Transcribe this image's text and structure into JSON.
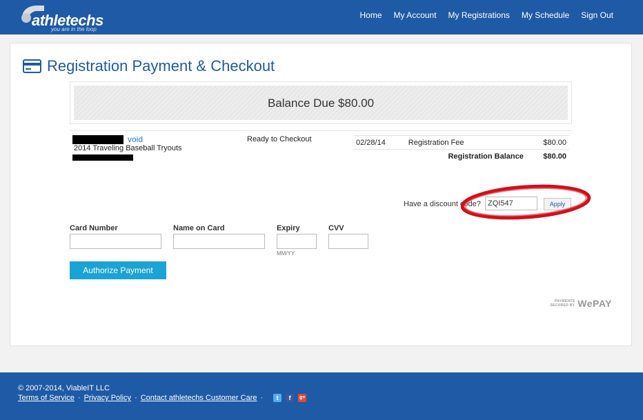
{
  "header": {
    "logo_text": "athletechs",
    "logo_tagline": "you are in the loop",
    "nav": [
      "Home",
      "My Account",
      "My Registrations",
      "My Schedule",
      "Sign Out"
    ]
  },
  "page": {
    "title": "Registration Payment & Checkout",
    "balance_text": "Balance Due $80.00"
  },
  "registration": {
    "void_label": "void",
    "event_name": "2014 Traveling Baseball Tryouts",
    "status": "Ready to Checkout",
    "fees": [
      {
        "date": "02/28/14",
        "description": "Registration Fee",
        "amount": "$80.00"
      }
    ],
    "balance_label": "Registration Balance",
    "balance_amount": "$80.00"
  },
  "discount": {
    "label": "Have a discount code?",
    "value": "ZQI547",
    "apply_label": "Apply"
  },
  "card_form": {
    "card_number_label": "Card Number",
    "name_label": "Name on Card",
    "expiry_label": "Expiry",
    "expiry_hint": "MM/YY",
    "cvv_label": "CVV",
    "submit_label": "Authorize Payment"
  },
  "wepay": {
    "small_line1": "PAYMENTS",
    "small_line2": "SECURED BY",
    "brand": "WePAY"
  },
  "footer": {
    "copyright": "© 2007-2014, ViableIT LLC",
    "links": [
      "Terms of Service",
      "Privacy Policy",
      "Contact athletechs Customer Care"
    ],
    "social": [
      {
        "icon": "twitter-icon",
        "glyph": "t",
        "color": "#55acee"
      },
      {
        "icon": "facebook-icon",
        "glyph": "f",
        "color": "#3b5998"
      },
      {
        "icon": "google-plus-icon",
        "glyph": "g+",
        "color": "#dd4b39"
      }
    ]
  },
  "colors": {
    "header_blue": "#1f5aa6",
    "button_blue": "#1aa3d4",
    "annotation_red": "#d0101a"
  }
}
